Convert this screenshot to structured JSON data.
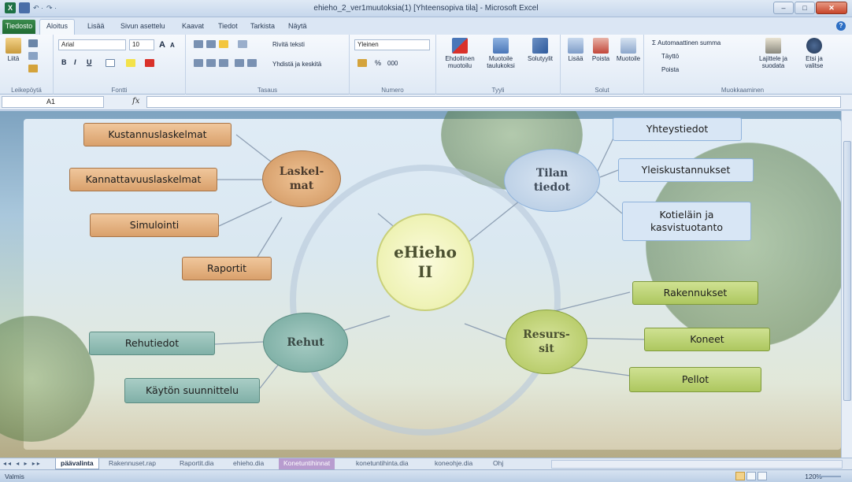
{
  "window": {
    "title": "ehieho_2_ver1muutoksia(1) [Yhteensopiva tila] - Microsoft Excel",
    "min": "–",
    "max": "□",
    "close": "✕"
  },
  "quick_access": {
    "app": "X",
    "undo": "↶ ·",
    "redo": "↷ ·"
  },
  "ribbon_tabs": [
    "Tiedosto",
    "Aloitus",
    "Lisää",
    "Sivun asettelu",
    "Kaavat",
    "Tiedot",
    "Tarkista",
    "Näytä"
  ],
  "ribbon": {
    "clipboard": {
      "paste": "Liitä",
      "label": "Leikepöytä"
    },
    "font": {
      "name": "Arial",
      "size": "10",
      "label": "Fontti",
      "grow": "A",
      "shrink": "A",
      "bold": "B",
      "italic": "I",
      "underline": "U"
    },
    "alignment": {
      "wrap": "Rivitä teksti",
      "merge": "Yhdistä ja keskitä",
      "label": "Tasaus"
    },
    "number": {
      "format": "Yleinen",
      "label": "Numero",
      "percent": "%",
      "thousands": "000"
    },
    "styles": {
      "conditional": "Ehdollinen muotoilu",
      "table": "Muotoile taulukoksi",
      "cell": "Solutyylit",
      "label": "Tyyli"
    },
    "cells": {
      "insert": "Lisää",
      "delete": "Poista",
      "format": "Muotoile",
      "label": "Solut"
    },
    "editing": {
      "autosum": "Σ Automaattinen summa",
      "fill": "Täyttö",
      "clear": "Poista",
      "sort": "Lajittele ja suodata",
      "find": "Etsi ja valitse",
      "label": "Muokkaaminen"
    }
  },
  "formula_bar": {
    "name_box": "A1",
    "fx": "fx",
    "value": ""
  },
  "mindmap": {
    "center": [
      "eHieho",
      "II"
    ],
    "laskelmat": [
      "Laskel-",
      "mat"
    ],
    "tilan": [
      "Tilan",
      "tiedot"
    ],
    "resurssit": [
      "Resurs-",
      "sit"
    ],
    "rehut": "Rehut",
    "kustannus": "Kustannuslaskelmat",
    "kannattavuus": "Kannattavuuslaskelmat",
    "simulointi": "Simulointi",
    "raportit": "Raportit",
    "yhteystiedot": "Yhteystiedot",
    "yleiskustannukset": "Yleiskustannukset",
    "kotielain": [
      "Kotieläin ja",
      "kasvistuotanto"
    ],
    "rakennukset": "Rakennukset",
    "koneet": "Koneet",
    "pellot": "Pellot",
    "rehutiedot": "Rehutiedot",
    "kaytton": "Käytön suunnittelu"
  },
  "sheet_tabs": [
    "päävalinta",
    "Rakennuset.rap",
    "Raportit.dia",
    "ehieho.dia",
    "Konetuntihinnat",
    "konetuntihinta.dia",
    "koneohje.dia",
    "Ohj"
  ],
  "status": {
    "ready": "Valmis",
    "zoom": "120%"
  },
  "colors": {
    "accent": "#1e7145",
    "ribbon": "#dfe9f5"
  }
}
